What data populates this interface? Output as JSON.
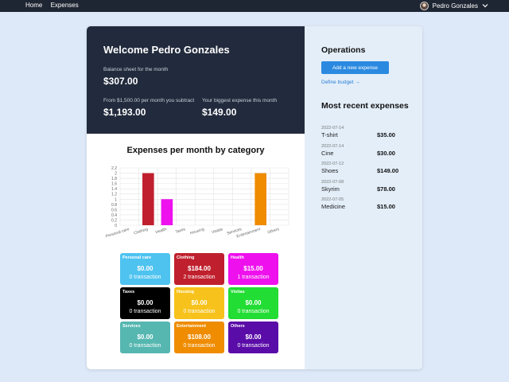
{
  "nav": {
    "home": "Home",
    "expenses": "Expenses",
    "user_name": "Pedro Gonzales",
    "chevron": "chevron-down"
  },
  "hero": {
    "welcome": "Welcome Pedro Gonzales",
    "balance_label": "Balance sheet for the month",
    "balance_value": "$307.00",
    "subtract_label": "From $1,500.00 per month you subtract",
    "subtract_value": "$1,193.00",
    "biggest_label": "Your biggest expense this month",
    "biggest_value": "$149.00"
  },
  "chart_data": {
    "type": "bar",
    "title": "Expenses per month by category",
    "categories": [
      "Personal care",
      "Clothing",
      "Health",
      "Taxes",
      "Housing",
      "Visitas",
      "Services",
      "Entertainment",
      "Others"
    ],
    "values": [
      0,
      2,
      1,
      0,
      0,
      0,
      0,
      2,
      0
    ],
    "colors": [
      "#4fc3f0",
      "#c0202e",
      "#ee11ee",
      "#111111",
      "#f7c21b",
      "#22dd33",
      "#55b7b0",
      "#ef8c00",
      "#5a0ca8"
    ],
    "yticks": [
      "0",
      "0.2",
      "0.4",
      "0.6",
      "0.8",
      "1",
      "1.2",
      "1.4",
      "1.6",
      "1.8",
      "2",
      "2.2"
    ],
    "ylim": [
      0,
      2.2
    ]
  },
  "tiles": [
    {
      "name": "Personal care",
      "amount": "$0.00",
      "count": "0 transaction",
      "color": "#4fc3f0"
    },
    {
      "name": "Clothing",
      "amount": "$184.00",
      "count": "2 transaction",
      "color": "#c0202e"
    },
    {
      "name": "Health",
      "amount": "$15.00",
      "count": "1 transaction",
      "color": "#ee11ee"
    },
    {
      "name": "Taxes",
      "amount": "$0.00",
      "count": "0 transaction",
      "color": "#000000"
    },
    {
      "name": "Housing",
      "amount": "$0.00",
      "count": "0 transaction",
      "color": "#f7c21b"
    },
    {
      "name": "Visitas",
      "amount": "$0.00",
      "count": "0 transaction",
      "color": "#22dd33"
    },
    {
      "name": "Services",
      "amount": "$0.00",
      "count": "0 transaction",
      "color": "#55b7b0"
    },
    {
      "name": "Entertainment",
      "amount": "$108.00",
      "count": "0 transaction",
      "color": "#ef8c00"
    },
    {
      "name": "Others",
      "amount": "$0.00",
      "count": "0 transaction",
      "color": "#5a0ca8"
    }
  ],
  "operations": {
    "title": "Operations",
    "add_button": "Add a new expense",
    "budget_link": "Define budget →"
  },
  "recent": {
    "title": "Most recent expenses",
    "items": [
      {
        "date": "2022-07-14",
        "name": "T-shirt",
        "amount": "$35.00"
      },
      {
        "date": "2022-07-14",
        "name": "Cine",
        "amount": "$30.00"
      },
      {
        "date": "2022-07-12",
        "name": "Shoes",
        "amount": "$149.00"
      },
      {
        "date": "2022-07-08",
        "name": "Skyrim",
        "amount": "$78.00"
      },
      {
        "date": "2022-07-05",
        "name": "Medicine",
        "amount": "$15.00"
      }
    ]
  }
}
